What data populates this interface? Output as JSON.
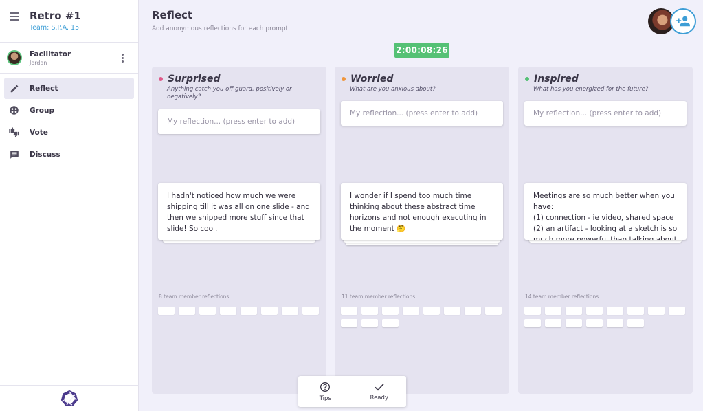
{
  "sidebar": {
    "retro_title": "Retro #1",
    "team": "Team: S.P.A. 15",
    "facilitator": {
      "title": "Facilitator",
      "name": "Jordan"
    },
    "nav": [
      {
        "label": "Reflect",
        "icon": "pencil-icon",
        "active": true
      },
      {
        "label": "Group",
        "icon": "group-icon",
        "active": false
      },
      {
        "label": "Vote",
        "icon": "thumbs-icon",
        "active": false
      },
      {
        "label": "Discuss",
        "icon": "chat-icon",
        "active": false
      }
    ]
  },
  "header": {
    "title": "Reflect",
    "subtitle": "Add anonymous reflections for each prompt",
    "timer": "2:00:08:26"
  },
  "columns": [
    {
      "title": "Surprised",
      "color": "#e05a8a",
      "description": "Anything catch you off guard, positively or negatively?",
      "placeholder": "My reflection... (press enter to add)",
      "card_text": "I hadn't noticed how much we were shipping till it was all on one slide - and then we shipped more stuff since that slide! So cool.",
      "count_label": "8 team member reflections",
      "chip_count": 8
    },
    {
      "title": "Worried",
      "color": "#f0963c",
      "description": "What are you anxious about?",
      "placeholder": "My reflection... (press enter to add)",
      "card_text": "I wonder if I spend too much time thinking about these abstract time horizons and not enough executing in the moment 🤔",
      "count_label": "11 team member reflections",
      "chip_count": 11
    },
    {
      "title": "Inspired",
      "color": "#55c175",
      "description": "What has you energized for the future?",
      "placeholder": "My reflection... (press enter to add)",
      "card_text": "Meetings are so much better when you have:\n(1) connection - ie video, shared space\n(2) an artifact - looking at a sketch is so much more powerful than talking about it",
      "count_label": "14 team member reflections",
      "chip_count": 14
    }
  ],
  "bottom_bar": {
    "tips_label": "Tips",
    "ready_label": "Ready"
  },
  "colors": {
    "accent": "#3d9ed6",
    "timer": "#55c175",
    "column_bg": "#e5e3f0"
  }
}
